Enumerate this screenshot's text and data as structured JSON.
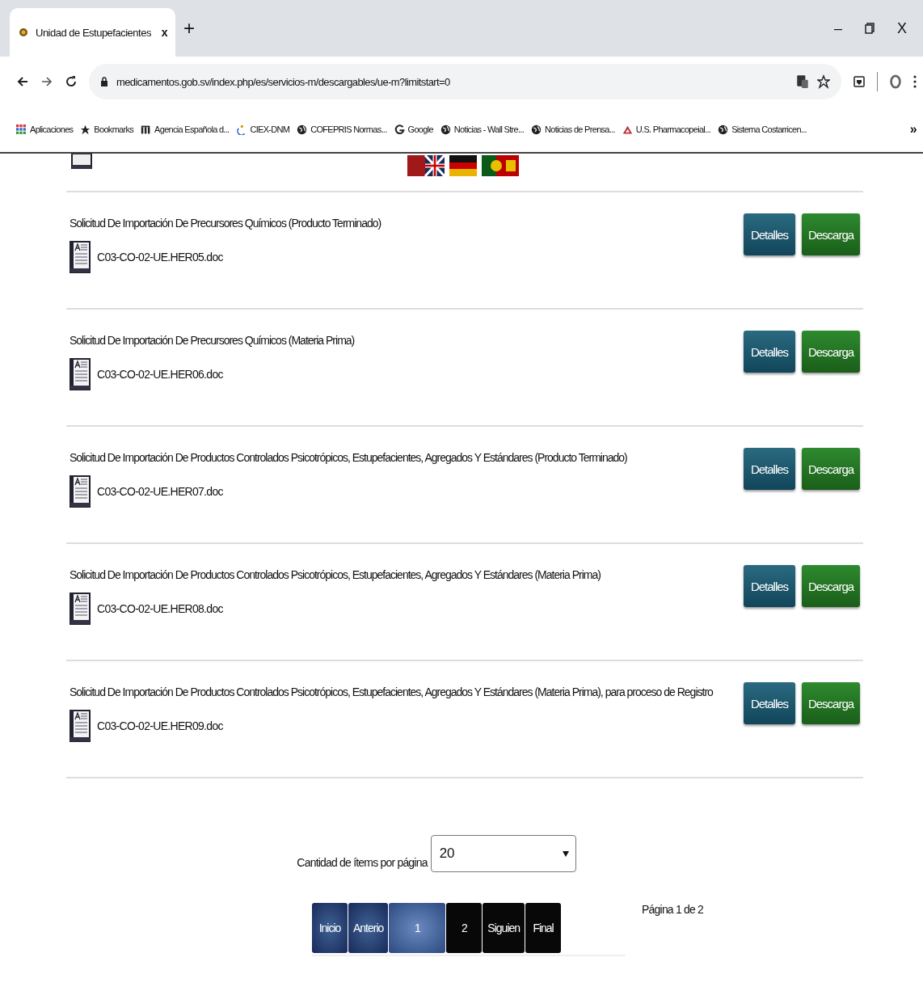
{
  "browser": {
    "tab_title": "Unidad de Estupefacientes",
    "tab_close": "x",
    "new_tab": "+",
    "window_controls": [
      "–",
      "X"
    ],
    "url": "medicamentos.gob.sv/index.php/es/servicios-m/descargables/ue-m?limitstart=0",
    "bookmarks": [
      {
        "label": "Aplicaciones",
        "kind": "apps"
      },
      {
        "label": "Bookmarks",
        "kind": "star"
      },
      {
        "label": "Agencia Española d...",
        "kind": "agency"
      },
      {
        "label": "CIEX-DNM",
        "kind": "ciex"
      },
      {
        "label": "COFEPRIS Normas...",
        "kind": "globe"
      },
      {
        "label": "Google",
        "kind": "google"
      },
      {
        "label": "Noticias - Wall Stre...",
        "kind": "globe"
      },
      {
        "label": "Noticias de Prensa...",
        "kind": "globe"
      },
      {
        "label": "U.S. Pharmacopeial...",
        "kind": "triangle"
      },
      {
        "label": "Sistema Costarricen...",
        "kind": "globe"
      }
    ],
    "more": "»"
  },
  "documents": [
    {
      "title": "Solicitud De Importación De Precursores Químicos (Producto Terminado)",
      "file": "C03-CO-02-UE.HER05.doc",
      "details": "Detalles",
      "download": "Descarga"
    },
    {
      "title": "Solicitud De Importación De Precursores Químicos (Materia Prima)",
      "file": "C03-CO-02-UE.HER06.doc",
      "details": "Detalles",
      "download": "Descarga"
    },
    {
      "title": "Solicitud De Importación De Productos Controlados Psicotrópicos, Estupefacientes, Agregados Y Estándares (Producto Terminado)",
      "file": "C03-CO-02-UE.HER07.doc",
      "details": "Detalles",
      "download": "Descarga"
    },
    {
      "title": "Solicitud De Importación De Productos Controlados Psicotrópicos, Estupefacientes, Agregados Y Estándares (Materia Prima)",
      "file": "C03-CO-02-UE.HER08.doc",
      "details": "Detalles",
      "download": "Descarga"
    },
    {
      "title": "Solicitud De Importación De Productos Controlados Psicotrópicos, Estupefacientes, Agregados Y Estándares (Materia Prima), para proceso de Registro",
      "file": "C03-CO-02-UE.HER09.doc",
      "details": "Detalles",
      "download": "Descarga"
    }
  ],
  "page_size": {
    "label": "Cantidad de ítems por página",
    "value": "20"
  },
  "pagination": [
    {
      "label": "Inicio",
      "selected": false,
      "disabled": true
    },
    {
      "label": "Anterio",
      "selected": false,
      "disabled": true
    },
    {
      "label": "1",
      "selected": true,
      "disabled": false
    },
    {
      "label": "2",
      "selected": false,
      "disabled": false
    },
    {
      "label": "Siguien",
      "selected": false,
      "disabled": false
    },
    {
      "label": "Final",
      "selected": false,
      "disabled": false
    }
  ],
  "page_info": "Página 1 de 2"
}
